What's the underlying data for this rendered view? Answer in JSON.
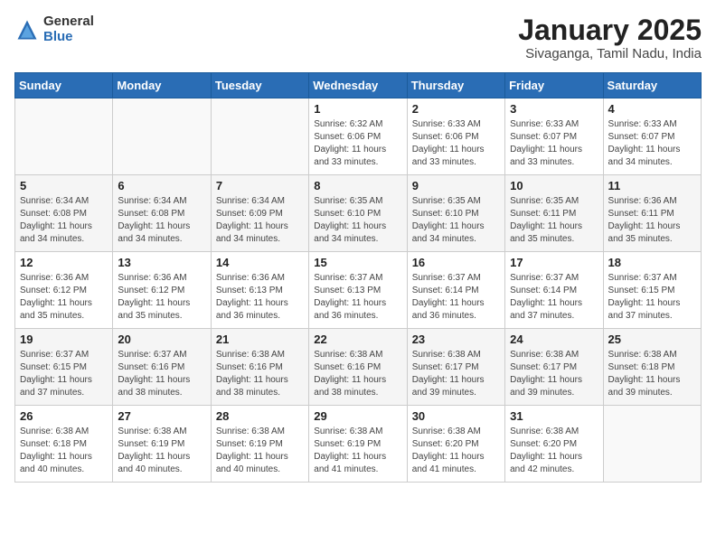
{
  "logo": {
    "general": "General",
    "blue": "Blue"
  },
  "title": "January 2025",
  "subtitle": "Sivaganga, Tamil Nadu, India",
  "days_header": [
    "Sunday",
    "Monday",
    "Tuesday",
    "Wednesday",
    "Thursday",
    "Friday",
    "Saturday"
  ],
  "weeks": [
    [
      {
        "day": "",
        "info": ""
      },
      {
        "day": "",
        "info": ""
      },
      {
        "day": "",
        "info": ""
      },
      {
        "day": "1",
        "info": "Sunrise: 6:32 AM\nSunset: 6:06 PM\nDaylight: 11 hours\nand 33 minutes."
      },
      {
        "day": "2",
        "info": "Sunrise: 6:33 AM\nSunset: 6:06 PM\nDaylight: 11 hours\nand 33 minutes."
      },
      {
        "day": "3",
        "info": "Sunrise: 6:33 AM\nSunset: 6:07 PM\nDaylight: 11 hours\nand 33 minutes."
      },
      {
        "day": "4",
        "info": "Sunrise: 6:33 AM\nSunset: 6:07 PM\nDaylight: 11 hours\nand 34 minutes."
      }
    ],
    [
      {
        "day": "5",
        "info": "Sunrise: 6:34 AM\nSunset: 6:08 PM\nDaylight: 11 hours\nand 34 minutes."
      },
      {
        "day": "6",
        "info": "Sunrise: 6:34 AM\nSunset: 6:08 PM\nDaylight: 11 hours\nand 34 minutes."
      },
      {
        "day": "7",
        "info": "Sunrise: 6:34 AM\nSunset: 6:09 PM\nDaylight: 11 hours\nand 34 minutes."
      },
      {
        "day": "8",
        "info": "Sunrise: 6:35 AM\nSunset: 6:10 PM\nDaylight: 11 hours\nand 34 minutes."
      },
      {
        "day": "9",
        "info": "Sunrise: 6:35 AM\nSunset: 6:10 PM\nDaylight: 11 hours\nand 34 minutes."
      },
      {
        "day": "10",
        "info": "Sunrise: 6:35 AM\nSunset: 6:11 PM\nDaylight: 11 hours\nand 35 minutes."
      },
      {
        "day": "11",
        "info": "Sunrise: 6:36 AM\nSunset: 6:11 PM\nDaylight: 11 hours\nand 35 minutes."
      }
    ],
    [
      {
        "day": "12",
        "info": "Sunrise: 6:36 AM\nSunset: 6:12 PM\nDaylight: 11 hours\nand 35 minutes."
      },
      {
        "day": "13",
        "info": "Sunrise: 6:36 AM\nSunset: 6:12 PM\nDaylight: 11 hours\nand 35 minutes."
      },
      {
        "day": "14",
        "info": "Sunrise: 6:36 AM\nSunset: 6:13 PM\nDaylight: 11 hours\nand 36 minutes."
      },
      {
        "day": "15",
        "info": "Sunrise: 6:37 AM\nSunset: 6:13 PM\nDaylight: 11 hours\nand 36 minutes."
      },
      {
        "day": "16",
        "info": "Sunrise: 6:37 AM\nSunset: 6:14 PM\nDaylight: 11 hours\nand 36 minutes."
      },
      {
        "day": "17",
        "info": "Sunrise: 6:37 AM\nSunset: 6:14 PM\nDaylight: 11 hours\nand 37 minutes."
      },
      {
        "day": "18",
        "info": "Sunrise: 6:37 AM\nSunset: 6:15 PM\nDaylight: 11 hours\nand 37 minutes."
      }
    ],
    [
      {
        "day": "19",
        "info": "Sunrise: 6:37 AM\nSunset: 6:15 PM\nDaylight: 11 hours\nand 37 minutes."
      },
      {
        "day": "20",
        "info": "Sunrise: 6:37 AM\nSunset: 6:16 PM\nDaylight: 11 hours\nand 38 minutes."
      },
      {
        "day": "21",
        "info": "Sunrise: 6:38 AM\nSunset: 6:16 PM\nDaylight: 11 hours\nand 38 minutes."
      },
      {
        "day": "22",
        "info": "Sunrise: 6:38 AM\nSunset: 6:16 PM\nDaylight: 11 hours\nand 38 minutes."
      },
      {
        "day": "23",
        "info": "Sunrise: 6:38 AM\nSunset: 6:17 PM\nDaylight: 11 hours\nand 39 minutes."
      },
      {
        "day": "24",
        "info": "Sunrise: 6:38 AM\nSunset: 6:17 PM\nDaylight: 11 hours\nand 39 minutes."
      },
      {
        "day": "25",
        "info": "Sunrise: 6:38 AM\nSunset: 6:18 PM\nDaylight: 11 hours\nand 39 minutes."
      }
    ],
    [
      {
        "day": "26",
        "info": "Sunrise: 6:38 AM\nSunset: 6:18 PM\nDaylight: 11 hours\nand 40 minutes."
      },
      {
        "day": "27",
        "info": "Sunrise: 6:38 AM\nSunset: 6:19 PM\nDaylight: 11 hours\nand 40 minutes."
      },
      {
        "day": "28",
        "info": "Sunrise: 6:38 AM\nSunset: 6:19 PM\nDaylight: 11 hours\nand 40 minutes."
      },
      {
        "day": "29",
        "info": "Sunrise: 6:38 AM\nSunset: 6:19 PM\nDaylight: 11 hours\nand 41 minutes."
      },
      {
        "day": "30",
        "info": "Sunrise: 6:38 AM\nSunset: 6:20 PM\nDaylight: 11 hours\nand 41 minutes."
      },
      {
        "day": "31",
        "info": "Sunrise: 6:38 AM\nSunset: 6:20 PM\nDaylight: 11 hours\nand 42 minutes."
      },
      {
        "day": "",
        "info": ""
      }
    ]
  ]
}
